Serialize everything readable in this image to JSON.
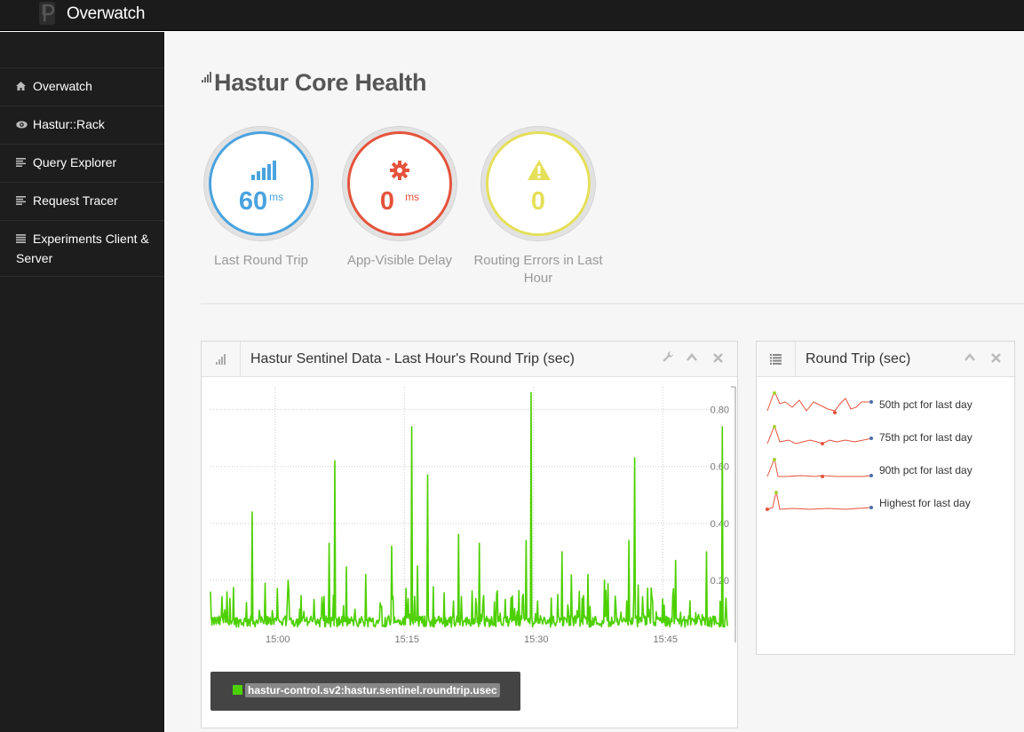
{
  "app": {
    "name": "Overwatch"
  },
  "sidebar": {
    "items": [
      {
        "label": "Overwatch",
        "icon": "home-icon"
      },
      {
        "label": "Hastur::Rack",
        "icon": "eye-icon"
      },
      {
        "label": "Query Explorer",
        "icon": "list-icon"
      },
      {
        "label": "Request Tracer",
        "icon": "list-icon"
      },
      {
        "label": "Experiments Client & Server",
        "icon": "list-icon"
      }
    ]
  },
  "page": {
    "title": "Hastur Core Health"
  },
  "stats": [
    {
      "value": "60",
      "unit": "ms",
      "caption": "Last Round Trip",
      "color": "#4aa3df",
      "icon": "signal-bars-icon"
    },
    {
      "value": "0",
      "unit": "ms",
      "caption": "App-Visible Delay",
      "color": "#e5533c",
      "icon": "gear-icon"
    },
    {
      "value": "0",
      "unit": "",
      "caption": "Routing Errors in Last Hour",
      "color": "#e5df5a",
      "icon": "warning-icon"
    }
  ],
  "sentinel_panel": {
    "title": "Hastur Sentinel Data - Last Hour's Round Trip (sec)",
    "legend": "hastur-control.sv2:hastur.sentinel.roundtrip.usec",
    "series_color": "#4cd000"
  },
  "roundtrip_panel": {
    "title": "Round Trip (sec)",
    "rows": [
      {
        "label": "50th pct for last day"
      },
      {
        "label": "75th pct for last day"
      },
      {
        "label": "90th pct for last day"
      },
      {
        "label": "Highest for last day"
      }
    ]
  },
  "chart_data": {
    "type": "line",
    "y_ticks": [
      "0.20",
      "0.40",
      "0.60",
      "0.80"
    ],
    "x_ticks": [
      "15:00",
      "15:15",
      "15:30",
      "15:45"
    ],
    "ylim": [
      0,
      0.88
    ],
    "grid": true,
    "series": [
      {
        "name": "hastur-control.sv2:hastur.sentinel.roundtrip.usec",
        "peaks": [
          {
            "t": 0.08,
            "y": 0.44
          },
          {
            "t": 0.15,
            "y": 0.2
          },
          {
            "t": 0.23,
            "y": 0.33
          },
          {
            "t": 0.24,
            "y": 0.62
          },
          {
            "t": 0.3,
            "y": 0.22
          },
          {
            "t": 0.35,
            "y": 0.32
          },
          {
            "t": 0.39,
            "y": 0.34
          },
          {
            "t": 0.4,
            "y": 0.25
          },
          {
            "t": 0.39,
            "y": 0.74
          },
          {
            "t": 0.42,
            "y": 0.57
          },
          {
            "t": 0.48,
            "y": 0.36
          },
          {
            "t": 0.52,
            "y": 0.33
          },
          {
            "t": 0.61,
            "y": 0.34
          },
          {
            "t": 0.62,
            "y": 0.86
          },
          {
            "t": 0.68,
            "y": 0.3
          },
          {
            "t": 0.73,
            "y": 0.22
          },
          {
            "t": 0.81,
            "y": 0.34
          },
          {
            "t": 0.82,
            "y": 0.63
          },
          {
            "t": 0.9,
            "y": 0.27
          },
          {
            "t": 0.96,
            "y": 0.3
          },
          {
            "t": 0.99,
            "y": 0.74
          }
        ]
      }
    ]
  }
}
